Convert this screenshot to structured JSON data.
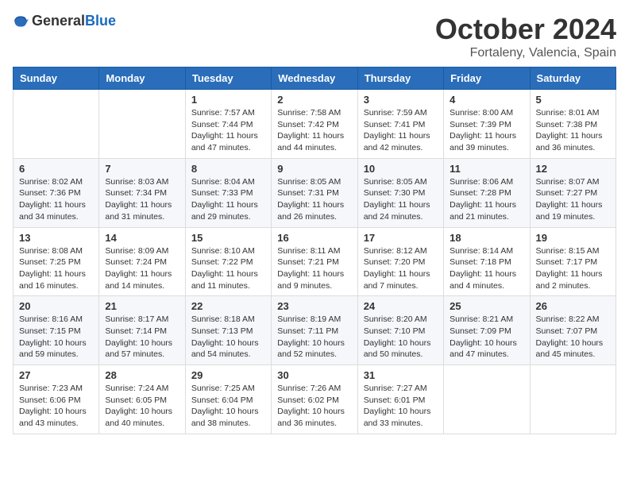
{
  "logo": {
    "text_general": "General",
    "text_blue": "Blue"
  },
  "header": {
    "month": "October 2024",
    "location": "Fortaleny, Valencia, Spain"
  },
  "weekdays": [
    "Sunday",
    "Monday",
    "Tuesday",
    "Wednesday",
    "Thursday",
    "Friday",
    "Saturday"
  ],
  "weeks": [
    [
      null,
      null,
      {
        "day": 1,
        "sunrise": "Sunrise: 7:57 AM",
        "sunset": "Sunset: 7:44 PM",
        "daylight": "Daylight: 11 hours and 47 minutes."
      },
      {
        "day": 2,
        "sunrise": "Sunrise: 7:58 AM",
        "sunset": "Sunset: 7:42 PM",
        "daylight": "Daylight: 11 hours and 44 minutes."
      },
      {
        "day": 3,
        "sunrise": "Sunrise: 7:59 AM",
        "sunset": "Sunset: 7:41 PM",
        "daylight": "Daylight: 11 hours and 42 minutes."
      },
      {
        "day": 4,
        "sunrise": "Sunrise: 8:00 AM",
        "sunset": "Sunset: 7:39 PM",
        "daylight": "Daylight: 11 hours and 39 minutes."
      },
      {
        "day": 5,
        "sunrise": "Sunrise: 8:01 AM",
        "sunset": "Sunset: 7:38 PM",
        "daylight": "Daylight: 11 hours and 36 minutes."
      }
    ],
    [
      {
        "day": 6,
        "sunrise": "Sunrise: 8:02 AM",
        "sunset": "Sunset: 7:36 PM",
        "daylight": "Daylight: 11 hours and 34 minutes."
      },
      {
        "day": 7,
        "sunrise": "Sunrise: 8:03 AM",
        "sunset": "Sunset: 7:34 PM",
        "daylight": "Daylight: 11 hours and 31 minutes."
      },
      {
        "day": 8,
        "sunrise": "Sunrise: 8:04 AM",
        "sunset": "Sunset: 7:33 PM",
        "daylight": "Daylight: 11 hours and 29 minutes."
      },
      {
        "day": 9,
        "sunrise": "Sunrise: 8:05 AM",
        "sunset": "Sunset: 7:31 PM",
        "daylight": "Daylight: 11 hours and 26 minutes."
      },
      {
        "day": 10,
        "sunrise": "Sunrise: 8:05 AM",
        "sunset": "Sunset: 7:30 PM",
        "daylight": "Daylight: 11 hours and 24 minutes."
      },
      {
        "day": 11,
        "sunrise": "Sunrise: 8:06 AM",
        "sunset": "Sunset: 7:28 PM",
        "daylight": "Daylight: 11 hours and 21 minutes."
      },
      {
        "day": 12,
        "sunrise": "Sunrise: 8:07 AM",
        "sunset": "Sunset: 7:27 PM",
        "daylight": "Daylight: 11 hours and 19 minutes."
      }
    ],
    [
      {
        "day": 13,
        "sunrise": "Sunrise: 8:08 AM",
        "sunset": "Sunset: 7:25 PM",
        "daylight": "Daylight: 11 hours and 16 minutes."
      },
      {
        "day": 14,
        "sunrise": "Sunrise: 8:09 AM",
        "sunset": "Sunset: 7:24 PM",
        "daylight": "Daylight: 11 hours and 14 minutes."
      },
      {
        "day": 15,
        "sunrise": "Sunrise: 8:10 AM",
        "sunset": "Sunset: 7:22 PM",
        "daylight": "Daylight: 11 hours and 11 minutes."
      },
      {
        "day": 16,
        "sunrise": "Sunrise: 8:11 AM",
        "sunset": "Sunset: 7:21 PM",
        "daylight": "Daylight: 11 hours and 9 minutes."
      },
      {
        "day": 17,
        "sunrise": "Sunrise: 8:12 AM",
        "sunset": "Sunset: 7:20 PM",
        "daylight": "Daylight: 11 hours and 7 minutes."
      },
      {
        "day": 18,
        "sunrise": "Sunrise: 8:14 AM",
        "sunset": "Sunset: 7:18 PM",
        "daylight": "Daylight: 11 hours and 4 minutes."
      },
      {
        "day": 19,
        "sunrise": "Sunrise: 8:15 AM",
        "sunset": "Sunset: 7:17 PM",
        "daylight": "Daylight: 11 hours and 2 minutes."
      }
    ],
    [
      {
        "day": 20,
        "sunrise": "Sunrise: 8:16 AM",
        "sunset": "Sunset: 7:15 PM",
        "daylight": "Daylight: 10 hours and 59 minutes."
      },
      {
        "day": 21,
        "sunrise": "Sunrise: 8:17 AM",
        "sunset": "Sunset: 7:14 PM",
        "daylight": "Daylight: 10 hours and 57 minutes."
      },
      {
        "day": 22,
        "sunrise": "Sunrise: 8:18 AM",
        "sunset": "Sunset: 7:13 PM",
        "daylight": "Daylight: 10 hours and 54 minutes."
      },
      {
        "day": 23,
        "sunrise": "Sunrise: 8:19 AM",
        "sunset": "Sunset: 7:11 PM",
        "daylight": "Daylight: 10 hours and 52 minutes."
      },
      {
        "day": 24,
        "sunrise": "Sunrise: 8:20 AM",
        "sunset": "Sunset: 7:10 PM",
        "daylight": "Daylight: 10 hours and 50 minutes."
      },
      {
        "day": 25,
        "sunrise": "Sunrise: 8:21 AM",
        "sunset": "Sunset: 7:09 PM",
        "daylight": "Daylight: 10 hours and 47 minutes."
      },
      {
        "day": 26,
        "sunrise": "Sunrise: 8:22 AM",
        "sunset": "Sunset: 7:07 PM",
        "daylight": "Daylight: 10 hours and 45 minutes."
      }
    ],
    [
      {
        "day": 27,
        "sunrise": "Sunrise: 7:23 AM",
        "sunset": "Sunset: 6:06 PM",
        "daylight": "Daylight: 10 hours and 43 minutes."
      },
      {
        "day": 28,
        "sunrise": "Sunrise: 7:24 AM",
        "sunset": "Sunset: 6:05 PM",
        "daylight": "Daylight: 10 hours and 40 minutes."
      },
      {
        "day": 29,
        "sunrise": "Sunrise: 7:25 AM",
        "sunset": "Sunset: 6:04 PM",
        "daylight": "Daylight: 10 hours and 38 minutes."
      },
      {
        "day": 30,
        "sunrise": "Sunrise: 7:26 AM",
        "sunset": "Sunset: 6:02 PM",
        "daylight": "Daylight: 10 hours and 36 minutes."
      },
      {
        "day": 31,
        "sunrise": "Sunrise: 7:27 AM",
        "sunset": "Sunset: 6:01 PM",
        "daylight": "Daylight: 10 hours and 33 minutes."
      },
      null,
      null
    ]
  ]
}
